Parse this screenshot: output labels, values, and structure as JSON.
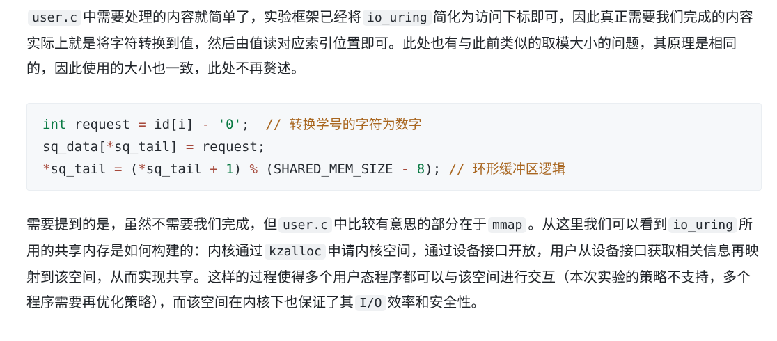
{
  "para1": {
    "code_user_c": "user.c",
    "t1": "中需要处理的内容就简单了，实验框架已经将",
    "code_io_uring": "io_uring",
    "t2": "简化为访问下标即可，因此真正需要我们完成的内容实际上就是将字符转换到值，然后由值读对应索引位置即可。此处也有与此前类似的取模大小的问题，其原理是相同的，因此使用的大小也一致，此处不再赘述。"
  },
  "code": {
    "line1": {
      "kw": "int",
      "a": " request ",
      "eq": "=",
      "b": " id[i] ",
      "minus": "-",
      "sp": " ",
      "str": "'0'",
      "semi": ";  ",
      "comment": "// 转换学号的字符为数字"
    },
    "line2": {
      "a": "sq_data[",
      "star": "*",
      "b": "sq_tail] ",
      "eq": "=",
      "c": " request;"
    },
    "line3": {
      "star1": "*",
      "a": "sq_tail ",
      "eq": "=",
      "b": " (",
      "star2": "*",
      "c": "sq_tail ",
      "plus": "+",
      "sp1": " ",
      "one": "1",
      "d": ") ",
      "mod": "%",
      "e": " (SHARED_MEM_SIZE ",
      "minus": "-",
      "sp2": " ",
      "eight": "8",
      "f": "); ",
      "comment": "// 环形缓冲区逻辑"
    }
  },
  "para2": {
    "t1": "需要提到的是，虽然不需要我们完成，但",
    "code_user_c": "user.c",
    "t2": "中比较有意思的部分在于",
    "code_mmap": "mmap",
    "t3": "。从这里我们可以看到",
    "code_io_uring": "io_uring",
    "t4": "所用的共享内存是如何构建的：内核通过",
    "code_kzalloc": "kzalloc",
    "t5": "申请内核空间，通过设备接口开放，用户从设备接口获取相关信息再映射到该空间，从而实现共享。这样的过程使得多个用户态程序都可以与该空间进行交互（本次实验的策略不支持，多个程序需要再优化策略），而该空间在内核下也保证了其",
    "code_io": "I/O",
    "t6": "效率和安全性。"
  }
}
